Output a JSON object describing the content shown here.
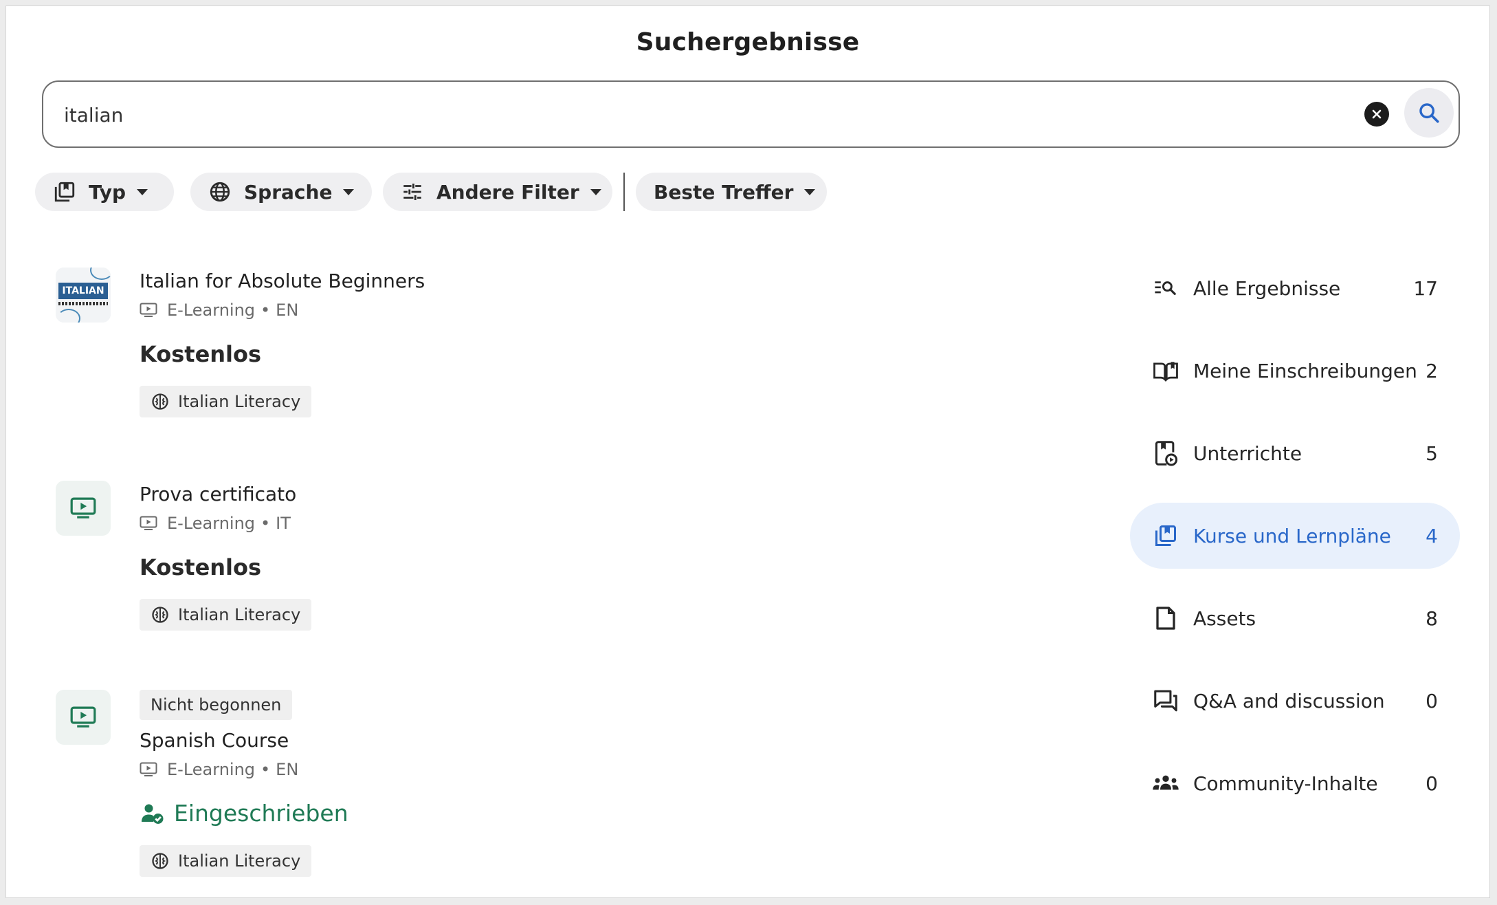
{
  "page": {
    "title": "Suchergebnisse"
  },
  "search": {
    "value": "italian"
  },
  "filters": {
    "type": "Typ",
    "language": "Sprache",
    "other": "Andere Filter",
    "sort": "Beste Treffer"
  },
  "results": [
    {
      "title": "Italian for Absolute Beginners",
      "thumb_text": "ITALIAN",
      "type": "E-Learning",
      "language": "EN",
      "price": "Kostenlos",
      "skill": "Italian Literacy"
    },
    {
      "title": "Prova certificato",
      "type": "E-Learning",
      "language": "IT",
      "price": "Kostenlos",
      "skill": "Italian Literacy"
    },
    {
      "status": "Nicht begonnen",
      "title": "Spanish Course",
      "type": "E-Learning",
      "language": "EN",
      "enrollment": "Eingeschrieben",
      "skill": "Italian Literacy"
    }
  ],
  "meta_separator": "•",
  "categories": [
    {
      "label": "Alle Ergebnisse",
      "count": "17",
      "icon": "search-list-icon"
    },
    {
      "label": "Meine Einschreibungen",
      "count": "2",
      "icon": "book-icon"
    },
    {
      "label": "Unterrichte",
      "count": "5",
      "icon": "lesson-icon"
    },
    {
      "label": "Kurse und Lernpläne",
      "count": "4",
      "icon": "course-library-icon",
      "active": true
    },
    {
      "label": "Assets",
      "count": "8",
      "icon": "document-icon"
    },
    {
      "label": "Q&A and discussion",
      "count": "0",
      "icon": "discussion-icon"
    },
    {
      "label": "Community-Inhalte",
      "count": "0",
      "icon": "community-icon"
    }
  ],
  "colors": {
    "accent": "#2967c9",
    "active_bg": "#e8f0fc",
    "enrolled": "#1f7a55"
  }
}
